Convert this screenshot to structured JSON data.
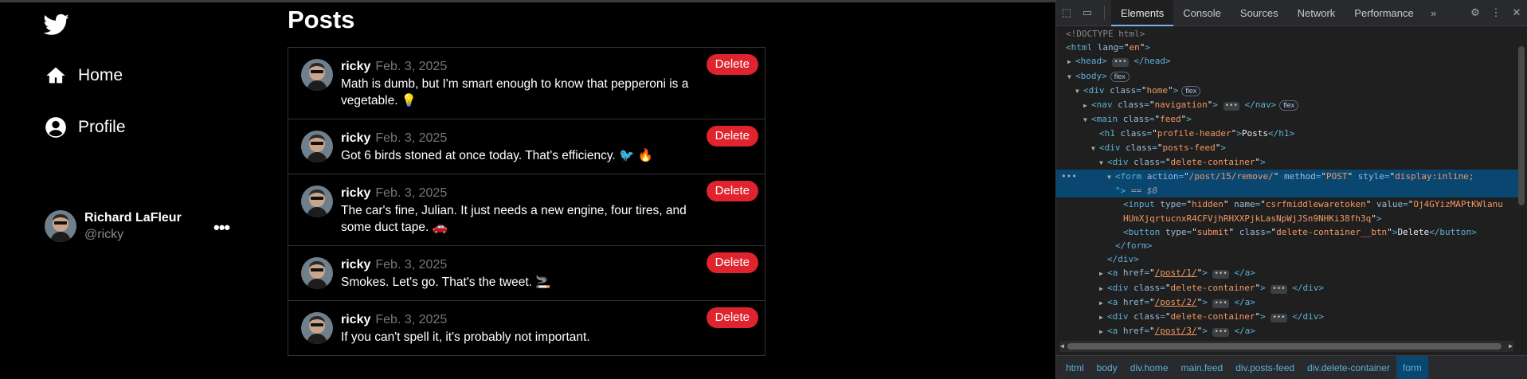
{
  "app": {
    "logo": "twitter-bird-icon",
    "nav": [
      {
        "label": "Home",
        "icon": "home-icon"
      },
      {
        "label": "Profile",
        "icon": "profile-icon"
      }
    ],
    "account": {
      "name": "Richard LaFleur",
      "handle": "@ricky",
      "more": "•••"
    }
  },
  "feed": {
    "title": "Posts",
    "delete_label": "Delete",
    "posts": [
      {
        "user": "ricky",
        "date": "Feb. 3, 2025",
        "text": "Math is dumb, but I'm smart enough to know that pepperoni is a vegetable. 💡"
      },
      {
        "user": "ricky",
        "date": "Feb. 3, 2025",
        "text": "Got 6 birds stoned at once today. That's efficiency. 🐦 🔥"
      },
      {
        "user": "ricky",
        "date": "Feb. 3, 2025",
        "text": "The car's fine, Julian. It just needs a new engine, four tires, and some duct tape. 🚗"
      },
      {
        "user": "ricky",
        "date": "Feb. 3, 2025",
        "text": "Smokes. Let's go. That's the tweet. 🚬"
      },
      {
        "user": "ricky",
        "date": "Feb. 3, 2025",
        "text": "If you can't spell it, it's probably not important."
      }
    ]
  },
  "devtools": {
    "tabs": [
      "Elements",
      "Console",
      "Sources",
      "Network",
      "Performance"
    ],
    "active_tab": "Elements",
    "tree": {
      "doctype": "<!DOCTYPE html>",
      "html_lang": "en",
      "badge_flex": "flex",
      "form_action": "/post/15/remove/",
      "form_method": "POST",
      "form_style": "display:inline;",
      "selected_suffix": "== $0",
      "csrf_name": "csrfmiddlewaretoken",
      "csrf_value_1": "Oj4GYizMAPtKWlanu",
      "csrf_value_2": "HUmXjqrtucnxR4CFVjhRHXXPjkLasNpWjJSn9NHKi38fh3q",
      "button_class": "delete-container__btn",
      "button_text": "Delete",
      "h1_text": "Posts",
      "links": [
        "/post/1/",
        "/post/2/",
        "/post/3/"
      ]
    },
    "breadcrumbs": [
      "html",
      "body",
      "div.home",
      "main.feed",
      "div.posts-feed",
      "div.delete-container",
      "form"
    ]
  }
}
